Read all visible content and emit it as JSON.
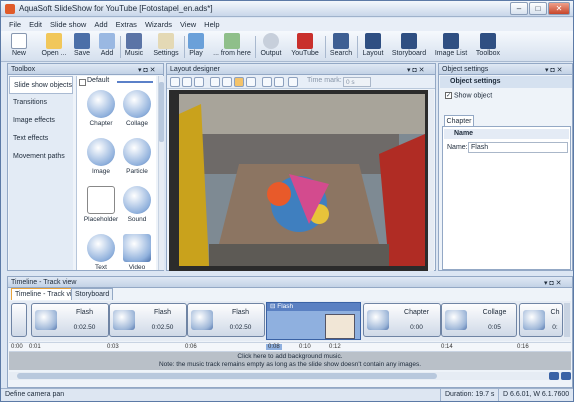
{
  "window": {
    "title": "AquaSoft SlideShow for YouTube [Fotostapel_en.ads*]",
    "buttons": [
      "–",
      "□",
      "✕"
    ]
  },
  "menu": [
    "File",
    "Edit",
    "Slide show",
    "Add",
    "Extras",
    "Wizards",
    "View",
    "Help"
  ],
  "toolbar": {
    "new": "New",
    "open": "Open ...",
    "save": "Save",
    "add": "Add",
    "music": "Music",
    "settings": "Settings",
    "play": "Play",
    "from_here": "... from here",
    "output": "Output",
    "youtube": "YouTube",
    "search": "Search",
    "layout": "Layout",
    "storyboard": "Storyboard",
    "image_list": "Image List",
    "toolbox": "Toolbox"
  },
  "toolbox": {
    "title": "Toolbox",
    "categories": [
      "Slide show objects",
      "Transitions",
      "Image effects",
      "Text effects",
      "Movement paths"
    ],
    "group": "Default",
    "items": [
      "Chapter",
      "Collage",
      "Image",
      "Particle",
      "Placeholder",
      "Sound",
      "Text",
      "Video"
    ]
  },
  "layout_designer": {
    "title": "Layout designer",
    "time_mark_label": "Time mark:",
    "time_mark_value": "0 s"
  },
  "object_settings": {
    "title": "Object settings",
    "section": "Object settings",
    "show_object": "Show object",
    "tab": "Chapter",
    "name_group": "Name",
    "name_label": "Name:",
    "name_value": "Flash"
  },
  "timeline": {
    "title": "Timeline - Track view",
    "tabs": [
      "Timeline - Track view",
      "Storyboard"
    ],
    "clips": [
      {
        "name": "Flash",
        "dur": "0:02.50"
      },
      {
        "name": "Flash",
        "dur": "0:02.50"
      },
      {
        "name": "Flash",
        "dur": "0:02.50"
      },
      {
        "name": "Chapter",
        "dur": "0:00"
      },
      {
        "name": "Collage",
        "dur": "0:05"
      },
      {
        "name": "Ch",
        "dur": "0:"
      }
    ],
    "selected_clip": "Flash",
    "ruler": [
      "0:00",
      "0:01",
      "0:03",
      "0:06",
      "0:08",
      "0:10",
      "0:12",
      "0:14",
      "0:16"
    ],
    "music_hint_1": "Click here to add background music.",
    "music_hint_2": "Note: the music track remains empty as long as the slide show doesn't contain any images."
  },
  "status": {
    "left": "Define camera pan",
    "duration": "Duration: 19.7 s",
    "version": "D 6.6.01, W 6.1.7600"
  }
}
